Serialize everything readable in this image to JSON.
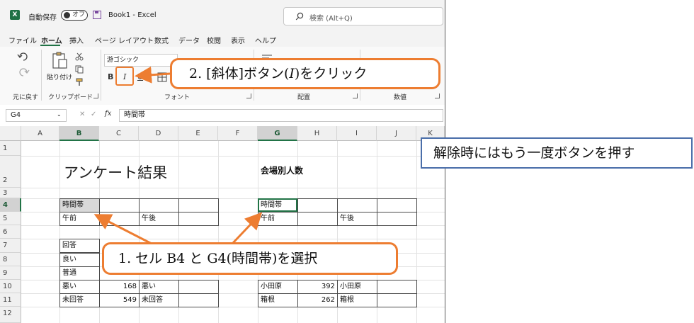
{
  "titlebar": {
    "logo_letter": "X",
    "autosave_label": "自動保存",
    "autosave_state": "オフ",
    "document_title": "Book1  -  Excel",
    "search_placeholder": "検索 (Alt+Q)"
  },
  "ribbon_tabs": [
    "ファイル",
    "ホーム",
    "挿入",
    "ページ レイアウト",
    "数式",
    "データ",
    "校閲",
    "表示",
    "ヘルプ"
  ],
  "ribbon": {
    "undo_group_label": "元に戻す",
    "paste_label": "貼り付け",
    "clipboard_group_label": "クリップボード",
    "font_name": "游ゴシック",
    "bold_label": "B",
    "italic_label": "I",
    "underline_label": "U",
    "font_group_label": "フォント",
    "alignment_group_label": "配置",
    "number_group_label": "数値"
  },
  "formula_bar": {
    "name_box": "G4",
    "fx_label": "fx",
    "content": "時間帯"
  },
  "columns": [
    "A",
    "B",
    "C",
    "D",
    "E",
    "F",
    "G",
    "H",
    "I",
    "J",
    "K"
  ],
  "rows": [
    "1",
    "2",
    "3",
    "4",
    "5",
    "6",
    "7",
    "8",
    "9",
    "10",
    "11",
    "12"
  ],
  "sheet": {
    "title_left": "アンケート結果",
    "title_right": "会場別人数",
    "b4": "時間帯",
    "b5": "午前",
    "d5": "午後",
    "g4": "時間帯",
    "g5": "午前",
    "i5": "午後",
    "b7": "回答",
    "b8": "良い",
    "b9": "普通",
    "b10": "悪い",
    "c10": "168",
    "d10": "悪い",
    "b11": "未回答",
    "c11": "549",
    "d11": "未回答",
    "g10": "小田原",
    "h10": "392",
    "i10": "小田原",
    "g11": "箱根",
    "h11": "262",
    "i11": "箱根"
  },
  "callouts": {
    "step2": "2.  [斜体]ボタン(𝐼)をクリック",
    "step1": "1.  セル B4 と G4(時間帯)を選択",
    "note": "解除時にはもう一度ボタンを押す"
  },
  "colors": {
    "accent_orange": "#ed7d31",
    "excel_green": "#217346",
    "note_border": "#4a6ea9"
  }
}
